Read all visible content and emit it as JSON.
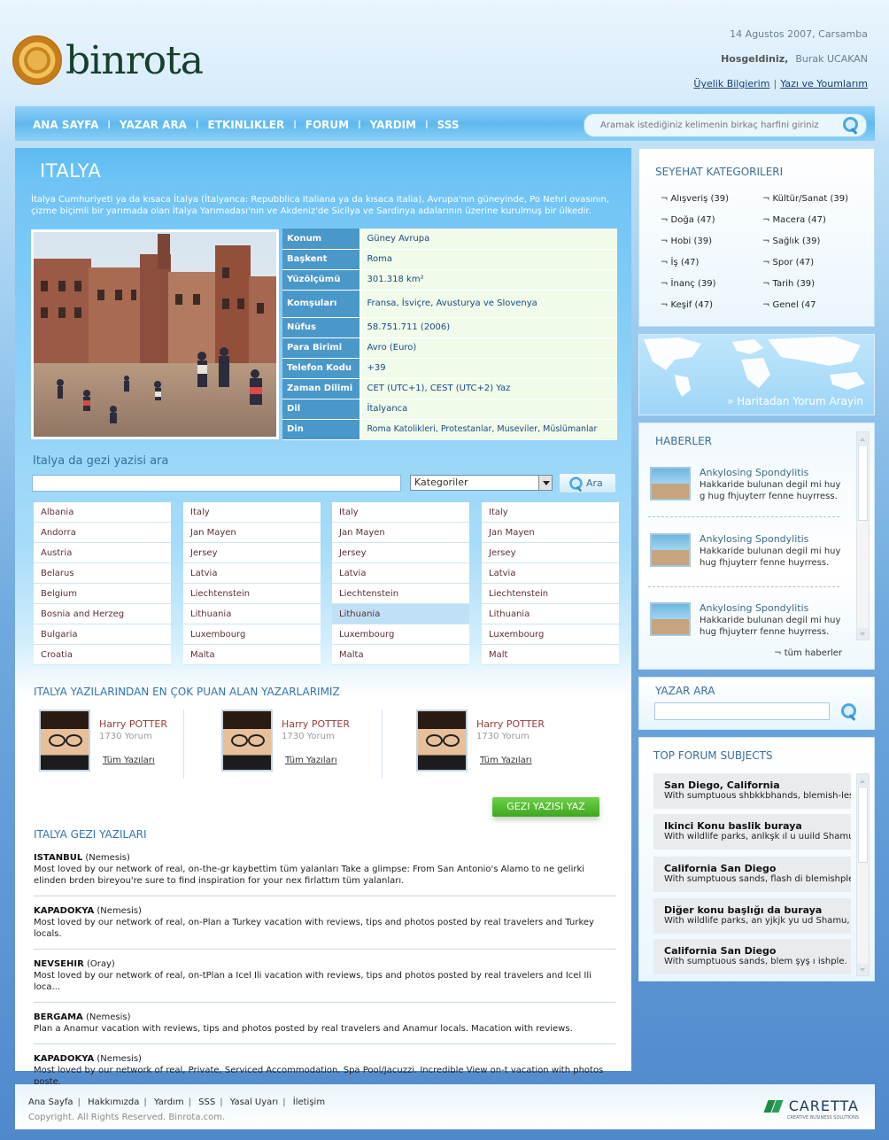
{
  "header": {
    "logo_text": "binrota",
    "date": "14 Agustos 2007, Carsamba",
    "welcome_label": "Hosgeldiniz,",
    "user_name": "Burak UCAKAN",
    "link_profile": "Üyelik Bilgierim",
    "link_posts": "Yazı ve Youmlarım"
  },
  "nav": {
    "items": [
      "ANA SAYFA",
      "YAZAR ARA",
      "ETKINLIKLER",
      "FORUM",
      "YARDIM",
      "SSS"
    ],
    "search_placeholder": "Aramak istediğiniz kelimenin birkaç harfini giriniz"
  },
  "country": {
    "title": "ITALYA",
    "intro": "İtalya Cumhuriyeti ya da kısaca İtalya (İtalyanca: Repubblica Italiana ya da kısaca Italia), Avrupa'nın güneyinde, Po Nehri ovasının, çizme biçimli bir yarımada olan İtalya Yarımadası'nın ve Akdeniz'de Sicilya ve Sardinya adalarının üzerine kurulmuş bir ülkedir.",
    "facts": [
      {
        "k": "Konum",
        "v": "Güney Avrupa"
      },
      {
        "k": "Başkent",
        "v": "Roma"
      },
      {
        "k": "Yüzölçümü",
        "v": "301.318 km²"
      },
      {
        "k": "Komşuları",
        "v": "Fransa, İsviçre, Avusturya ve Slovenya"
      },
      {
        "k": "Nüfus",
        "v": "58.751.711 (2006)"
      },
      {
        "k": "Para Birimi",
        "v": "Avro (Euro)"
      },
      {
        "k": "Telefon Kodu",
        "v": "+39"
      },
      {
        "k": "Zaman Dilimi",
        "v": "CET (UTC+1), CEST (UTC+2) Yaz"
      },
      {
        "k": "Dil",
        "v": "İtalyanca"
      },
      {
        "k": "Din",
        "v": "Roma Katolikleri, Protestanlar, Museviler, Müslümanlar"
      }
    ]
  },
  "search": {
    "heading": "Italya da gezi yazisi ara",
    "category_select": "Kategoriler",
    "button": "Ara"
  },
  "countries": [
    [
      "Albania",
      "Andorra",
      "Austria",
      "Belarus",
      "Belgium",
      "Bosnia and Herzeg",
      "Bulgaria",
      "Croatia"
    ],
    [
      "Italy",
      "Jan Mayen",
      "Jersey",
      "Latvia",
      "Liechtenstein",
      "Lithuania",
      "Luxembourg",
      "Malta"
    ],
    [
      "Italy",
      "Jan Mayen",
      "Jersey",
      "Latvia",
      "Liechtenstein",
      "Lithuania",
      "Luxembourg",
      "Malta"
    ],
    [
      "Italy",
      "Jan Mayen",
      "Jersey",
      "Latvia",
      "Liechtenstein",
      "Lithuania",
      "Luxembourg",
      "Malt"
    ]
  ],
  "top_authors": {
    "title": "ITALYA YAZILARINDAN EN ÇOK PUAN ALAN YAZARLARIMIZ",
    "items": [
      {
        "name": "Harry POTTER",
        "count": "1730 Yorum",
        "link": "Tüm Yazıları"
      },
      {
        "name": "Harry POTTER",
        "count": "1730 Yorum",
        "link": "Tüm Yazıları"
      },
      {
        "name": "Harry POTTER",
        "count": "1730 Yorum",
        "link": "Tüm Yazıları"
      }
    ],
    "write_button": "GEZI YAZISI YAZ"
  },
  "trips": {
    "title": "ITALYA GEZI YAZILARI",
    "items": [
      {
        "place": "ISTANBUL",
        "author": "(Nemesis)",
        "text": "Most loved by our network of real, on-the-gr kaybettim tüm yalanları Take a glimpse: From San Antonio's Alamo to ne gelirki elinden brden bireyou're sure to find inspiration for your nex firlattım tüm yalanları."
      },
      {
        "place": "KAPADOKYA",
        "author": "(Nemesis)",
        "text": "Most loved by our network of real, on-Plan a Turkey vacation with reviews, tips and photos posted by real travelers and Turkey locals."
      },
      {
        "place": "NEVSEHIR",
        "author": "(Oray)",
        "text": "Most loved by our network of real, on-tPlan a Icel Ili vacation with reviews, tips and photos posted by real travelers and Icel Ili loca..."
      },
      {
        "place": "BERGAMA",
        "author": "(Nemesis)",
        "text": "Plan a Anamur vacation with reviews, tips and photos posted by real travelers and Anamur locals. Macation with reviews."
      },
      {
        "place": "KAPADOKYA",
        "author": "(Nemesis)",
        "text": "Most loved by our network of real, Private, Serviced Accommodation. Spa Pool/Jacuzzi. Incredible View on-t vacation with photos poste."
      }
    ]
  },
  "categories": {
    "title": "SEYEHAT KATEGORILERI",
    "items": [
      "¬ Alışveriş  (39)",
      "¬ Kültür/Sanat (39)",
      "¬ Doğa (47)",
      "¬ Macera (47)",
      "¬ Hobi (39)",
      "¬ Sağlık (39)",
      "¬ İş (47)",
      "¬ Spor (47)",
      "¬ İnanç (39)",
      "¬ Tarih (39)",
      "¬ Keşif (47)",
      "¬ Genel (47"
    ]
  },
  "map": {
    "link": "» Haritadan Yorum Arayin"
  },
  "news": {
    "title": "HABERLER",
    "items": [
      {
        "title": "Ankylosing Spondylitis",
        "desc": "Hakkaride bulunan degil mi huy g hug fhjuyterr fenne huyrress."
      },
      {
        "title": "Ankylosing Spondylitis",
        "desc": "Hakkaride bulunan degil mi huy hug fhjuyterr fenne huyrress."
      },
      {
        "title": "Ankylosing Spondylitis",
        "desc": "Hakkaride bulunan degil mi huy hug fhjuyterr fenne huyrress."
      }
    ],
    "more": "¬ tüm haberler"
  },
  "author_search": {
    "title": "YAZAR ARA"
  },
  "forum": {
    "title": "TOP FORUM SUBJECTS",
    "items": [
      {
        "title": "San Diego, California",
        "desc": "With sumptuous shbkkbhands, blemish-less"
      },
      {
        "title": "Ikinci Konu baslik buraya",
        "desc": "With wildlife parks, anlkşk ıl u  uuild Shamu,"
      },
      {
        "title": "California San Diego",
        "desc": "With sumptuous sands, flash di blemishple."
      },
      {
        "title": "Diğer konu başlığı da buraya",
        "desc": "With wildlife parks, an yjkjk yu  ud Shamu,"
      },
      {
        "title": "California San Diego",
        "desc": "With sumptuous sands, blem şyş ı ishple."
      }
    ]
  },
  "footer": {
    "links": [
      "Ana Sayfa",
      "Hakkımızda",
      "Yardım",
      "SSS",
      "Yasal Uyarı",
      "İletişim"
    ],
    "copyright": "Copyright. All Rights Reserved. Binrota.com.",
    "brand": "CARETTA",
    "brand_sub": "CREATIVE BUSINESS SOLUTIONS"
  }
}
